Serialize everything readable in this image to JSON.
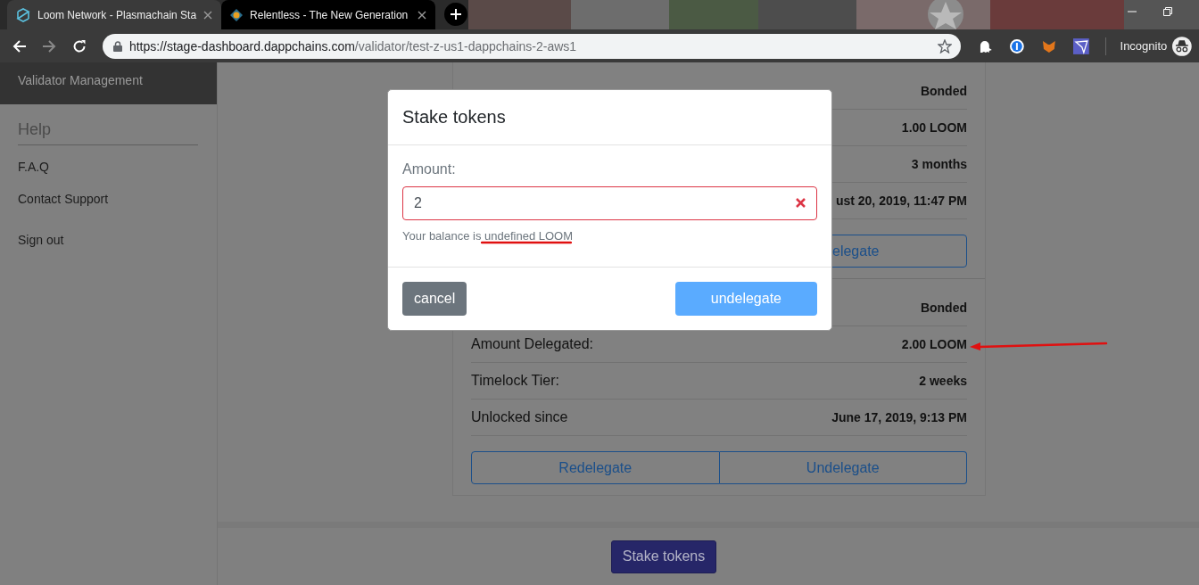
{
  "browser": {
    "tabs": [
      {
        "title": "Loom Network - Plasmachain Sta",
        "selected": true
      },
      {
        "title": "Relentless - The New Generation",
        "selected": false
      }
    ],
    "url": {
      "host": "https://stage-dashboard.dappchains.com",
      "path": "/validator/test-z-us1-dappchains-2-aws1"
    },
    "profile": "Incognito"
  },
  "sidebar": {
    "header": "Validator Management",
    "section": "Help",
    "items": [
      "F.A.Q",
      "Contact Support",
      "Sign out"
    ]
  },
  "stakes": [
    {
      "rows": [
        {
          "value": "Bonded"
        },
        {
          "value": "1.00 LOOM"
        },
        {
          "value": "3 months"
        },
        {
          "value": "ust 20, 2019, 11:47 PM"
        }
      ],
      "buttons": [
        "elegate"
      ]
    },
    {
      "rows": [
        {
          "value": "Bonded"
        },
        {
          "label": "Amount Delegated:",
          "value": "2.00 LOOM"
        },
        {
          "label": "Timelock Tier:",
          "value": "2 weeks"
        },
        {
          "label": "Unlocked since",
          "value": "June 17, 2019, 9:13 PM"
        }
      ],
      "buttons": [
        "Redelegate",
        "Undelegate"
      ]
    }
  ],
  "footer": {
    "button": "Stake tokens"
  },
  "modal": {
    "title": "Stake tokens",
    "label": "Amount:",
    "value": "2",
    "invalid": true,
    "help": "Your balance is undefined LOOM",
    "buttons": [
      {
        "label": "cancel",
        "kind": "secondary",
        "disabled": false
      },
      {
        "label": "undelegate",
        "kind": "primary",
        "disabled": true
      }
    ]
  },
  "marks": {
    "balance_underline": true,
    "value_arrow": true
  }
}
